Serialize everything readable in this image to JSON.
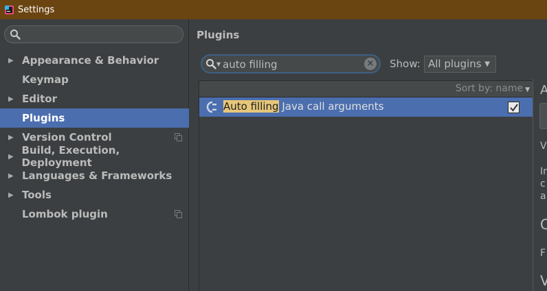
{
  "window": {
    "title": "Settings"
  },
  "sidebar": {
    "search_placeholder": "",
    "items": [
      {
        "label": "Appearance & Behavior",
        "expandable": true,
        "selected": false,
        "project_icon": false
      },
      {
        "label": "Keymap",
        "expandable": false,
        "selected": false,
        "project_icon": false
      },
      {
        "label": "Editor",
        "expandable": true,
        "selected": false,
        "project_icon": false
      },
      {
        "label": "Plugins",
        "expandable": false,
        "selected": true,
        "project_icon": false
      },
      {
        "label": "Version Control",
        "expandable": true,
        "selected": false,
        "project_icon": true
      },
      {
        "label": "Build, Execution, Deployment",
        "expandable": true,
        "selected": false,
        "project_icon": false
      },
      {
        "label": "Languages & Frameworks",
        "expandable": true,
        "selected": false,
        "project_icon": false
      },
      {
        "label": "Tools",
        "expandable": true,
        "selected": false,
        "project_icon": false
      },
      {
        "label": "Lombok plugin",
        "expandable": false,
        "selected": false,
        "project_icon": true
      }
    ]
  },
  "plugins": {
    "title": "Plugins",
    "search": {
      "value": "auto filling"
    },
    "show_label": "Show:",
    "show_value": "All plugins",
    "sort_label": "Sort by: name",
    "rows": [
      {
        "name_match": "Auto filling",
        "name_rest": " Java call arguments",
        "enabled": true
      }
    ]
  },
  "detail_panel": {
    "fragments": [
      "A",
      "V",
      "In",
      "c",
      "a",
      "C",
      "F",
      "V"
    ]
  },
  "colors": {
    "title_bar": "#6b4511",
    "background": "#3c3f41",
    "selection": "#4b6eaf",
    "search_highlight": "#e6c77a",
    "search_focus_border": "#3d6185"
  },
  "icons": {
    "app": "intellij-app-icon",
    "sidebar_search": "search-icon",
    "plugin_search": "search-dropdown-icon",
    "clear": "clear-icon",
    "plugin": "plugin-icon",
    "expand": "triangle-right-icon",
    "project_scope": "copy-icon"
  }
}
